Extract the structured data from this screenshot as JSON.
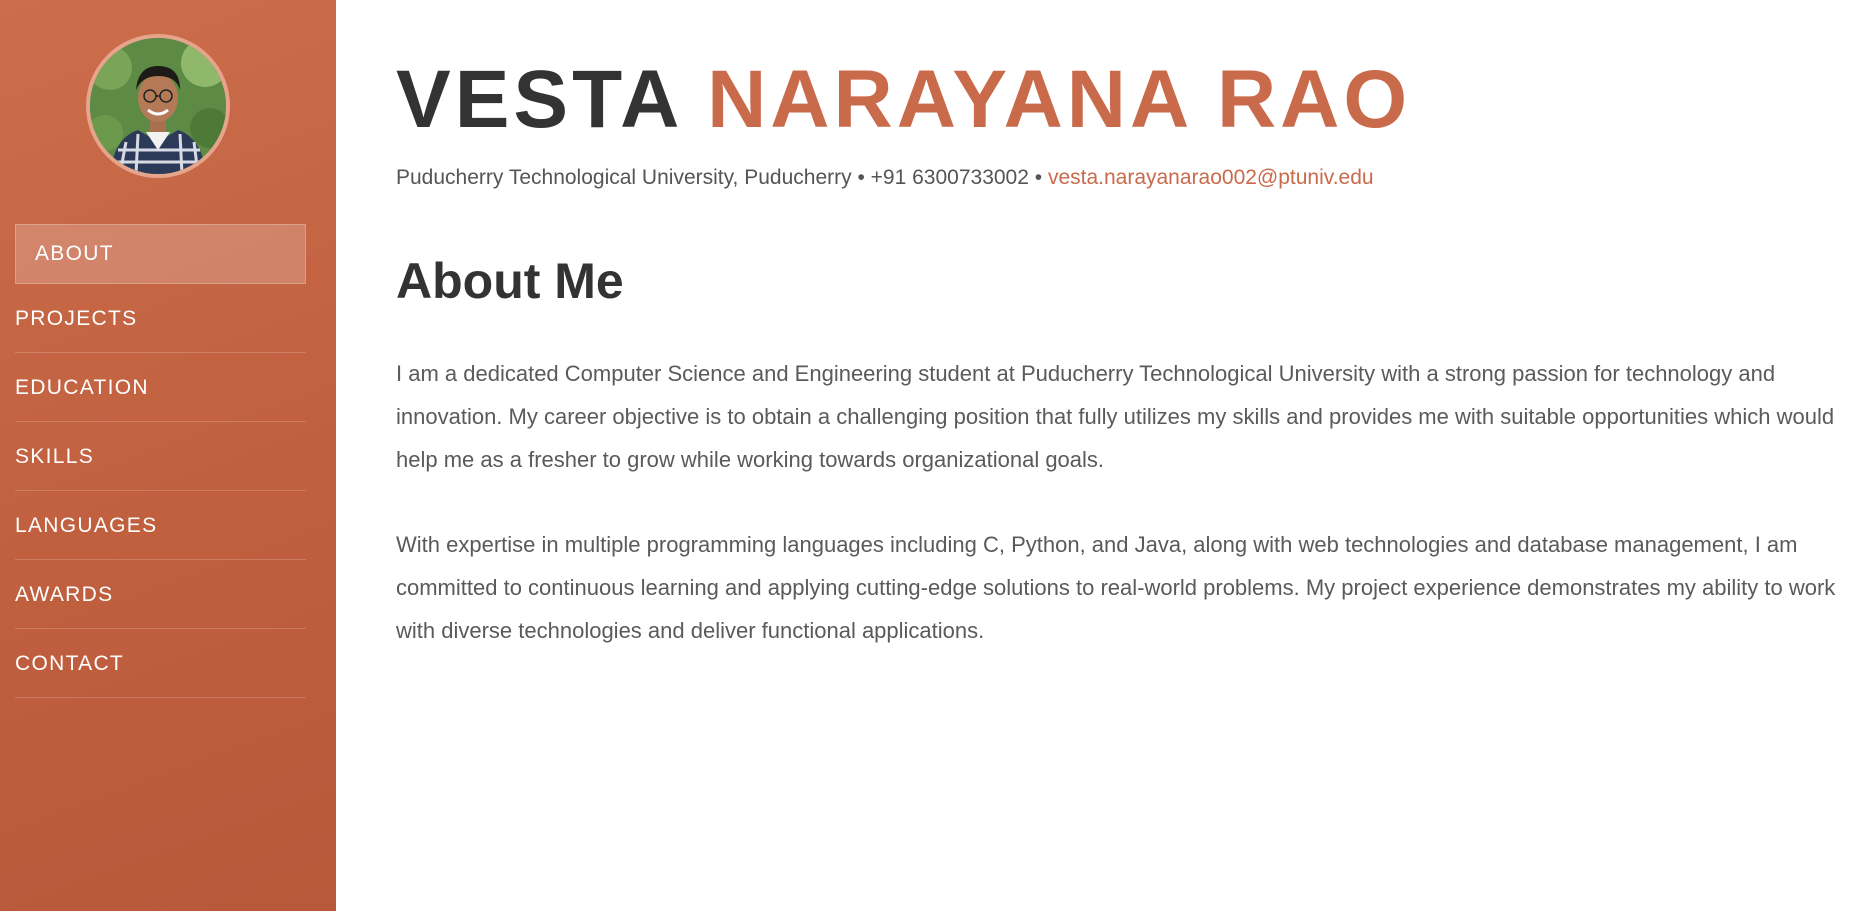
{
  "sidebar": {
    "nav": [
      {
        "label": "ABOUT",
        "active": true
      },
      {
        "label": "PROJECTS"
      },
      {
        "label": "EDUCATION"
      },
      {
        "label": "SKILLS"
      },
      {
        "label": "LANGUAGES"
      },
      {
        "label": "AWARDS"
      },
      {
        "label": "CONTACT"
      }
    ],
    "avatar_icon": "profile-photo"
  },
  "header": {
    "first_name": "VESTA",
    "last_name": "NARAYANA RAO",
    "address": "Puducherry Technological University, Puducherry",
    "separator": " • ",
    "phone": "+91 6300733002",
    "email": "vesta.narayanarao002@ptuniv.edu"
  },
  "about": {
    "title": "About Me",
    "paragraph_1": "I am a dedicated Computer Science and Engineering student at Puducherry Technological University with a strong passion for technology and innovation. My career objective is to obtain a challenging position that fully utilizes my skills and provides me with suitable opportunities which would help me as a fresher to grow while working towards organizational goals.",
    "paragraph_2": "With expertise in multiple programming languages including C, Python, and Java, along with web technologies and database management, I am committed to continuous learning and applying cutting-edge solutions to real-world problems. My project experience demonstrates my ability to work with diverse technologies and deliver functional applications."
  },
  "colors": {
    "accent": "#c96a4a",
    "sidebar": "#c0603f",
    "text_dark": "#333333",
    "text_body": "#5a5a5a"
  }
}
